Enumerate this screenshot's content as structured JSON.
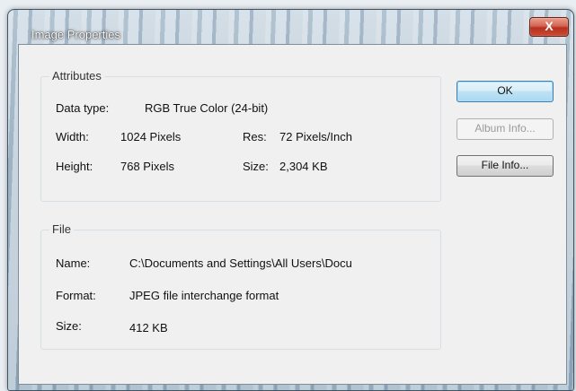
{
  "window": {
    "title": "Image Properties",
    "close_symbol": "X"
  },
  "attributes": {
    "legend": "Attributes",
    "data_type_label": "Data type:",
    "data_type_value": "RGB True Color (24-bit)",
    "width_label": "Width:",
    "width_value": "1024 Pixels",
    "res_label": "Res:",
    "res_value": "72 Pixels/Inch",
    "height_label": "Height:",
    "height_value": "768 Pixels",
    "size_label": "Size:",
    "size_value": "2,304 KB"
  },
  "file": {
    "legend": "File",
    "name_label": "Name:",
    "name_value": "C:\\Documents and Settings\\All Users\\Docu",
    "format_label": "Format:",
    "format_value": "JPEG file interchange format",
    "size_label": "Size:",
    "size_value": "412 KB"
  },
  "buttons": {
    "ok": "OK",
    "album_info": "Album Info...",
    "file_info": "File Info..."
  }
}
